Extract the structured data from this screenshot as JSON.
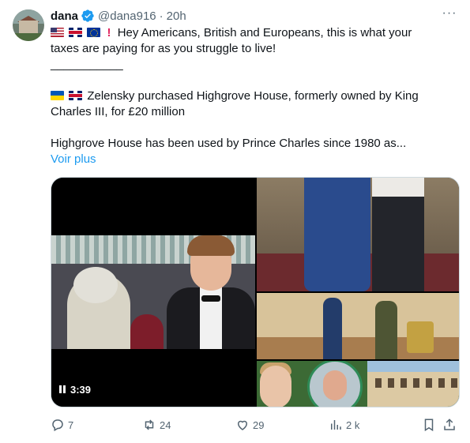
{
  "author": {
    "name": "dana",
    "handle": "@dana916",
    "separator": "·",
    "time": "20h"
  },
  "more_icon": "···",
  "post": {
    "line1_text": "Hey Americans, British and Europeans, this is what your",
    "line2_text": "taxes are paying for as you struggle to live!",
    "divider": "___________",
    "line3_text": "Zelensky purchased Highgrove House, formerly owned by King",
    "line4_text": "Charles III, for £20 million",
    "line5_text": "Highgrove House has been used by Prince Charles since 1980 as...",
    "read_more": "Voir plus",
    "emoji": [
      "us-flag",
      "uk-flag",
      "eu-flag",
      "red-exclamation",
      "ukraine-flag",
      "uk-flag"
    ]
  },
  "media": {
    "video_duration": "3:39"
  },
  "actions": {
    "replies": "7",
    "reposts": "24",
    "likes": "29",
    "views": "2 k"
  },
  "colors": {
    "link": "#1d9bf0",
    "muted": "#536471",
    "verified": "#1d9bf0"
  }
}
